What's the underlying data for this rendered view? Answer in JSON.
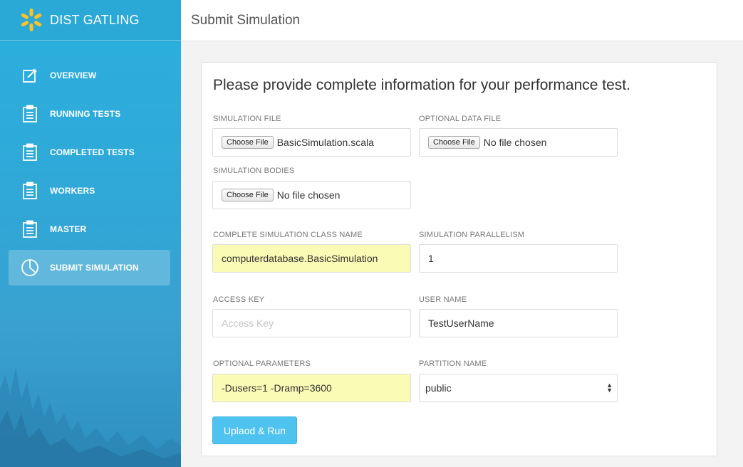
{
  "brand": {
    "name": "DIST GATLING",
    "color": "#ffc220"
  },
  "sidebar": {
    "items": [
      {
        "label": "OVERVIEW",
        "icon": "edit-icon",
        "active": false
      },
      {
        "label": "RUNNING TESTS",
        "icon": "clipboard-icon",
        "active": false
      },
      {
        "label": "COMPLETED TESTS",
        "icon": "clipboard-icon",
        "active": false
      },
      {
        "label": "WORKERS",
        "icon": "clipboard-icon",
        "active": false
      },
      {
        "label": "MASTER",
        "icon": "clipboard-icon",
        "active": false
      },
      {
        "label": "SUBMIT SIMULATION",
        "icon": "pie-chart-icon",
        "active": true
      }
    ]
  },
  "header": {
    "title": "Submit Simulation"
  },
  "form": {
    "heading": "Please provide complete information for your performance test.",
    "simulation_file": {
      "label": "SIMULATION FILE",
      "button": "Choose File",
      "value": "BasicSimulation.scala"
    },
    "data_file": {
      "label": "OPTIONAL DATA FILE",
      "button": "Choose File",
      "value": "No file chosen"
    },
    "bodies": {
      "label": "SIMULATION BODIES",
      "button": "Choose File",
      "value": "No file chosen"
    },
    "class_name": {
      "label": "COMPLETE SIMULATION CLASS NAME",
      "value": "computerdatabase.BasicSimulation"
    },
    "parallelism": {
      "label": "SIMULATION PARALLELISM",
      "value": "1"
    },
    "access_key": {
      "label": "ACCESS KEY",
      "value": "",
      "placeholder": "Access Key"
    },
    "user_name": {
      "label": "USER NAME",
      "value": "TestUserName"
    },
    "parameters": {
      "label": "OPTIONAL PARAMETERS",
      "value": "-Dusers=1 -Dramp=3600"
    },
    "partition": {
      "label": "PARTITION NAME",
      "value": "public"
    },
    "submit_label": "Uplaod & Run"
  },
  "colors": {
    "accent": "#4ec3ef",
    "sidebar": "#2bb0de",
    "autofill": "#fafbb5"
  }
}
